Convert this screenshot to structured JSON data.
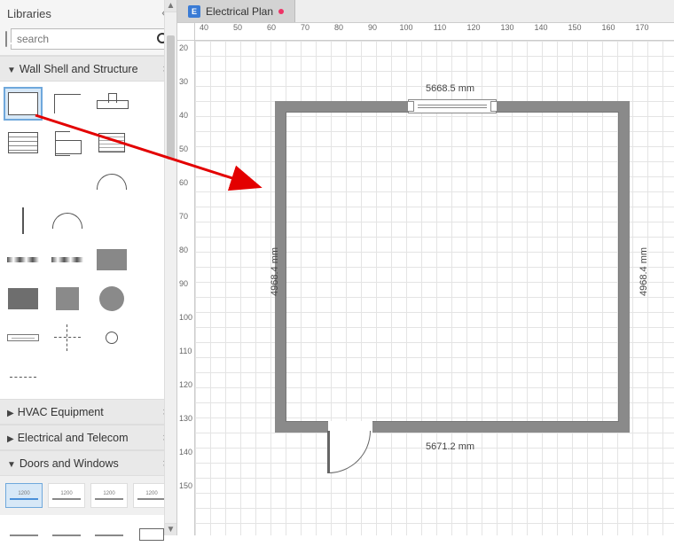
{
  "sidebar": {
    "title": "Libraries",
    "search_placeholder": "search",
    "sections": [
      {
        "label": "Wall Shell and Structure",
        "expanded": true
      },
      {
        "label": "HVAC Equipment",
        "expanded": false
      },
      {
        "label": "Electrical and Telecom",
        "expanded": false
      },
      {
        "label": "Doors and Windows",
        "expanded": true
      }
    ],
    "doors_windows_labels": [
      "1200",
      "1200",
      "1200",
      "1200"
    ]
  },
  "tab": {
    "icon_letter": "E",
    "title": "Electrical Plan",
    "modified": true
  },
  "ruler_h": [
    40,
    50,
    60,
    70,
    80,
    90,
    100,
    110,
    120,
    130,
    140,
    150,
    160,
    170
  ],
  "ruler_v": [
    20,
    30,
    40,
    50,
    60,
    70,
    80,
    90,
    100,
    110,
    120,
    130,
    140,
    150
  ],
  "dimensions": {
    "top": "5668.5 mm",
    "bottom": "5671.2 mm",
    "left": "4968.4 mm",
    "right": "4968.4 mm"
  }
}
